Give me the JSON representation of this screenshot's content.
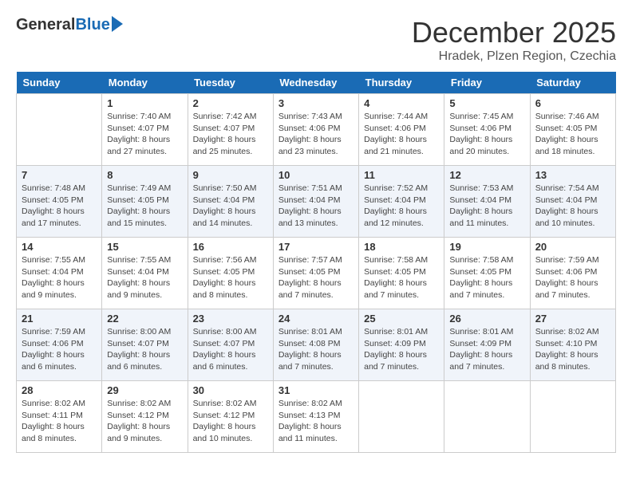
{
  "logo": {
    "general": "General",
    "blue": "Blue"
  },
  "title": "December 2025",
  "location": "Hradek, Plzen Region, Czechia",
  "days": [
    "Sunday",
    "Monday",
    "Tuesday",
    "Wednesday",
    "Thursday",
    "Friday",
    "Saturday"
  ],
  "weeks": [
    [
      {
        "date": "",
        "text": ""
      },
      {
        "date": "1",
        "text": "Sunrise: 7:40 AM\nSunset: 4:07 PM\nDaylight: 8 hours\nand 27 minutes."
      },
      {
        "date": "2",
        "text": "Sunrise: 7:42 AM\nSunset: 4:07 PM\nDaylight: 8 hours\nand 25 minutes."
      },
      {
        "date": "3",
        "text": "Sunrise: 7:43 AM\nSunset: 4:06 PM\nDaylight: 8 hours\nand 23 minutes."
      },
      {
        "date": "4",
        "text": "Sunrise: 7:44 AM\nSunset: 4:06 PM\nDaylight: 8 hours\nand 21 minutes."
      },
      {
        "date": "5",
        "text": "Sunrise: 7:45 AM\nSunset: 4:06 PM\nDaylight: 8 hours\nand 20 minutes."
      },
      {
        "date": "6",
        "text": "Sunrise: 7:46 AM\nSunset: 4:05 PM\nDaylight: 8 hours\nand 18 minutes."
      }
    ],
    [
      {
        "date": "7",
        "text": "Sunrise: 7:48 AM\nSunset: 4:05 PM\nDaylight: 8 hours\nand 17 minutes."
      },
      {
        "date": "8",
        "text": "Sunrise: 7:49 AM\nSunset: 4:05 PM\nDaylight: 8 hours\nand 15 minutes."
      },
      {
        "date": "9",
        "text": "Sunrise: 7:50 AM\nSunset: 4:04 PM\nDaylight: 8 hours\nand 14 minutes."
      },
      {
        "date": "10",
        "text": "Sunrise: 7:51 AM\nSunset: 4:04 PM\nDaylight: 8 hours\nand 13 minutes."
      },
      {
        "date": "11",
        "text": "Sunrise: 7:52 AM\nSunset: 4:04 PM\nDaylight: 8 hours\nand 12 minutes."
      },
      {
        "date": "12",
        "text": "Sunrise: 7:53 AM\nSunset: 4:04 PM\nDaylight: 8 hours\nand 11 minutes."
      },
      {
        "date": "13",
        "text": "Sunrise: 7:54 AM\nSunset: 4:04 PM\nDaylight: 8 hours\nand 10 minutes."
      }
    ],
    [
      {
        "date": "14",
        "text": "Sunrise: 7:55 AM\nSunset: 4:04 PM\nDaylight: 8 hours\nand 9 minutes."
      },
      {
        "date": "15",
        "text": "Sunrise: 7:55 AM\nSunset: 4:04 PM\nDaylight: 8 hours\nand 9 minutes."
      },
      {
        "date": "16",
        "text": "Sunrise: 7:56 AM\nSunset: 4:05 PM\nDaylight: 8 hours\nand 8 minutes."
      },
      {
        "date": "17",
        "text": "Sunrise: 7:57 AM\nSunset: 4:05 PM\nDaylight: 8 hours\nand 7 minutes."
      },
      {
        "date": "18",
        "text": "Sunrise: 7:58 AM\nSunset: 4:05 PM\nDaylight: 8 hours\nand 7 minutes."
      },
      {
        "date": "19",
        "text": "Sunrise: 7:58 AM\nSunset: 4:05 PM\nDaylight: 8 hours\nand 7 minutes."
      },
      {
        "date": "20",
        "text": "Sunrise: 7:59 AM\nSunset: 4:06 PM\nDaylight: 8 hours\nand 7 minutes."
      }
    ],
    [
      {
        "date": "21",
        "text": "Sunrise: 7:59 AM\nSunset: 4:06 PM\nDaylight: 8 hours\nand 6 minutes."
      },
      {
        "date": "22",
        "text": "Sunrise: 8:00 AM\nSunset: 4:07 PM\nDaylight: 8 hours\nand 6 minutes."
      },
      {
        "date": "23",
        "text": "Sunrise: 8:00 AM\nSunset: 4:07 PM\nDaylight: 8 hours\nand 6 minutes."
      },
      {
        "date": "24",
        "text": "Sunrise: 8:01 AM\nSunset: 4:08 PM\nDaylight: 8 hours\nand 7 minutes."
      },
      {
        "date": "25",
        "text": "Sunrise: 8:01 AM\nSunset: 4:09 PM\nDaylight: 8 hours\nand 7 minutes."
      },
      {
        "date": "26",
        "text": "Sunrise: 8:01 AM\nSunset: 4:09 PM\nDaylight: 8 hours\nand 7 minutes."
      },
      {
        "date": "27",
        "text": "Sunrise: 8:02 AM\nSunset: 4:10 PM\nDaylight: 8 hours\nand 8 minutes."
      }
    ],
    [
      {
        "date": "28",
        "text": "Sunrise: 8:02 AM\nSunset: 4:11 PM\nDaylight: 8 hours\nand 8 minutes."
      },
      {
        "date": "29",
        "text": "Sunrise: 8:02 AM\nSunset: 4:12 PM\nDaylight: 8 hours\nand 9 minutes."
      },
      {
        "date": "30",
        "text": "Sunrise: 8:02 AM\nSunset: 4:12 PM\nDaylight: 8 hours\nand 10 minutes."
      },
      {
        "date": "31",
        "text": "Sunrise: 8:02 AM\nSunset: 4:13 PM\nDaylight: 8 hours\nand 11 minutes."
      },
      {
        "date": "",
        "text": ""
      },
      {
        "date": "",
        "text": ""
      },
      {
        "date": "",
        "text": ""
      }
    ]
  ]
}
